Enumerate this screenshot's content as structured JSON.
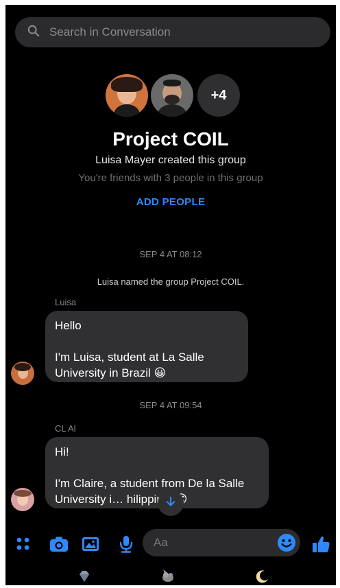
{
  "search": {
    "placeholder": "Search in Conversation"
  },
  "group": {
    "extra_members": "+4",
    "name": "Project COIL",
    "creator_line": "Luisa Mayer created this group",
    "friends_line": "You're friends with 3 people in this group",
    "add_people": "ADD PEOPLE"
  },
  "messages": {
    "timestamp_1": "SEP 4 AT 08:12",
    "system_1": "Luisa named the group Project COIL.",
    "sender_1": "Luisa",
    "msg_1_line_1": "Hello",
    "msg_1_line_2": "I'm Luisa, student at La Salle University in Brazil 😀",
    "timestamp_2": "SEP 4 AT 09:54",
    "sender_2": "CL Al",
    "msg_2_line_1": "Hi!",
    "msg_2_line_2": "I'm Claire, a student from De la Salle University i… hilippines😊"
  },
  "composer": {
    "placeholder": "Aa"
  },
  "colors": {
    "accent": "#2e89ff",
    "bubble": "#303032",
    "background": "#000000"
  },
  "icons": [
    "search-icon",
    "apps-icon",
    "camera-icon",
    "image-icon",
    "microphone-icon",
    "emoji-icon",
    "thumbs-up-icon",
    "arrow-down-icon"
  ]
}
